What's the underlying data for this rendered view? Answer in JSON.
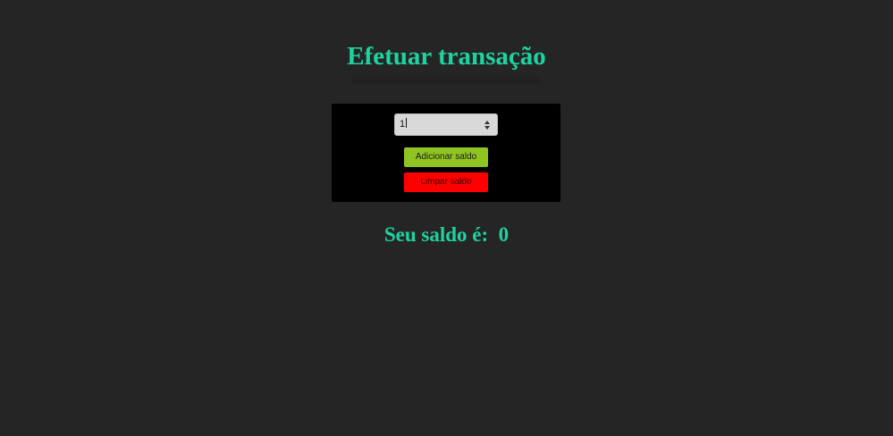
{
  "page": {
    "title": "Efetuar transação"
  },
  "form": {
    "amount_value": "1",
    "add_button_label": "Adicionar saldo",
    "clear_button_label": "Limpar saldo"
  },
  "balance": {
    "label": "Seu saldo é:",
    "value": "0"
  },
  "icons": {
    "spinner": "number-spinner-icon"
  },
  "colors": {
    "background": "#252525",
    "accent_text": "#1ed3a0",
    "panel": "#000000",
    "add_button": "#8fc423",
    "clear_button": "#ff0000"
  }
}
